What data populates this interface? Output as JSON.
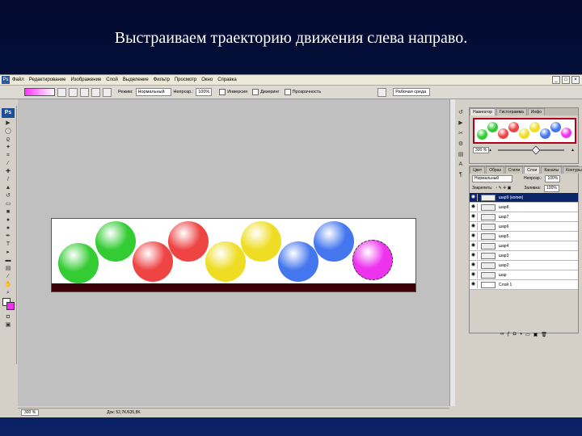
{
  "slide": {
    "title": "Выстраиваем траекторию движения слева направо."
  },
  "menu": {
    "items": [
      "Файл",
      "Редактирование",
      "Изображение",
      "Слой",
      "Выделение",
      "Фильтр",
      "Просмотр",
      "Окно",
      "Справка"
    ],
    "logo": "Ps"
  },
  "options": {
    "mode_label": "Режим:",
    "mode_value": "Нормальный",
    "opacity_label": "Непрозр.:",
    "opacity_value": "100%",
    "inversion": "Инверсия",
    "dither": "Дизеринг",
    "transparency": "Прозрачность",
    "workspace": "Рабочая среда"
  },
  "toolbox": {
    "logo": "Ps"
  },
  "canvas": {
    "floor_color": "#3b0006",
    "balls": [
      {
        "name": "green",
        "color": "#33cc33"
      },
      {
        "name": "green",
        "color": "#33cc33"
      },
      {
        "name": "red",
        "color": "#ee4444"
      },
      {
        "name": "red",
        "color": "#ee4444"
      },
      {
        "name": "yellow",
        "color": "#eedd22"
      },
      {
        "name": "yellow",
        "color": "#eedd22"
      },
      {
        "name": "blue",
        "color": "#4477ee"
      },
      {
        "name": "blue",
        "color": "#4477ee"
      },
      {
        "name": "magenta",
        "color": "#ee33ee"
      }
    ]
  },
  "status": {
    "zoom": "300 %",
    "doc": "Док: 52,7K/635,8K"
  },
  "navigator": {
    "tabs": [
      "Навигатор",
      "Гистограмма",
      "Инфо"
    ],
    "zoom": "300 %"
  },
  "layers": {
    "tabs": [
      "Цвет",
      "Образ",
      "Стили",
      "Слои",
      "Каналы",
      "Контуры"
    ],
    "blend": "Нормальный",
    "opacity_label": "Непрозр.:",
    "opacity": "100%",
    "lock_label": "Закрепить:",
    "fill_label": "Заливка:",
    "fill": "100%",
    "items": [
      "шар9 (копия)",
      "шар8",
      "шар7",
      "шар6",
      "шар5",
      "шар4",
      "шар3",
      "шар2",
      "шар",
      "Слой 1"
    ]
  }
}
